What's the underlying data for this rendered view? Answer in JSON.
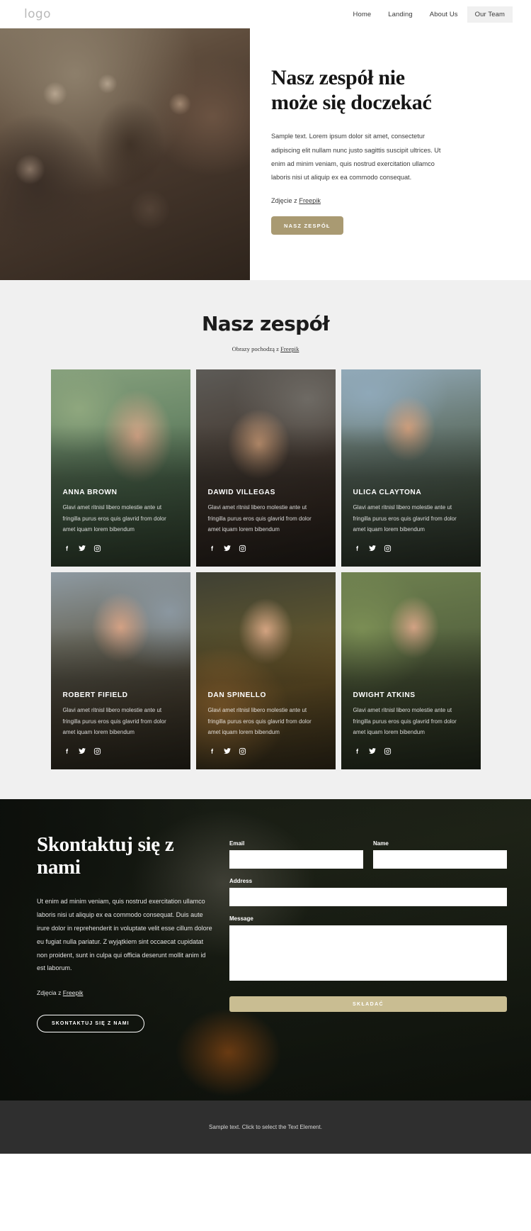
{
  "header": {
    "logo": "logo",
    "nav": [
      {
        "label": "Home",
        "active": false
      },
      {
        "label": "Landing",
        "active": false
      },
      {
        "label": "About Us",
        "active": false
      },
      {
        "label": "Our Team",
        "active": true
      }
    ]
  },
  "hero": {
    "title": "Nasz zespół nie może się doczekać",
    "paragraph": "Sample text. Lorem ipsum dolor sit amet, consectetur adipiscing elit nullam nunc justo sagittis suscipit ultrices. Ut enim ad minim veniam, quis nostrud exercitation ullamco laboris nisi ut aliquip ex ea commodo consequat.",
    "credit_prefix": "Zdjęcie z ",
    "credit_link": "Freepik",
    "cta_label": "NASZ ZESPÓŁ",
    "image_alt": "group-of-friends-outdoors-photo"
  },
  "team": {
    "title": "Nasz zespół",
    "subtitle_prefix": "Obrazy pochodzą z ",
    "subtitle_link": "Freepik",
    "members": [
      {
        "name": "ANNA BROWN",
        "description": "Glavi amet ritnisl libero molestie ante ut fringilla purus eros quis glavrid from dolor amet iquam lorem bibendum",
        "photo_class": "p1"
      },
      {
        "name": "DAWID VILLEGAS",
        "description": "Glavi amet ritnisl libero molestie ante ut fringilla purus eros quis glavrid from dolor amet iquam lorem bibendum",
        "photo_class": "p2"
      },
      {
        "name": "ULICA CLAYTONA",
        "description": "Glavi amet ritnisl libero molestie ante ut fringilla purus eros quis glavrid from dolor amet iquam lorem bibendum",
        "photo_class": "p3"
      },
      {
        "name": "ROBERT FIFIELD",
        "description": "Glavi amet ritnisl libero molestie ante ut fringilla purus eros quis glavrid from dolor amet iquam lorem bibendum",
        "photo_class": "p4"
      },
      {
        "name": "DAN SPINELLO",
        "description": "Glavi amet ritnisl libero molestie ante ut fringilla purus eros quis glavrid from dolor amet iquam lorem bibendum",
        "photo_class": "p5"
      },
      {
        "name": "DWIGHT ATKINS",
        "description": "Glavi amet ritnisl libero molestie ante ut fringilla purus eros quis glavrid from dolor amet iquam lorem bibendum",
        "photo_class": "p6"
      }
    ],
    "social_icons": [
      "facebook-icon",
      "twitter-icon",
      "instagram-icon"
    ]
  },
  "contact": {
    "title": "Skontaktuj się z nami",
    "paragraph": "Ut enim ad minim veniam, quis nostrud exercitation ullamco laboris nisi ut aliquip ex ea commodo consequat. Duis aute irure dolor in reprehenderit in voluptate velit esse cillum dolore eu fugiat nulla pariatur. Z wyjątkiem sint occaecat cupidatat non proident, sunt in culpa qui officia deserunt mollit anim id est laborum.",
    "credit_prefix": "Zdjęcia z ",
    "credit_link": "Freepik",
    "cta_label": "SKONTAKTUJ SIĘ Z NAMI",
    "form": {
      "email_label": "Email",
      "email_value": "",
      "email_placeholder": "",
      "name_label": "Name",
      "name_value": "",
      "name_placeholder": "",
      "address_label": "Address",
      "address_value": "",
      "address_placeholder": "",
      "message_label": "Message",
      "message_value": "",
      "message_placeholder": "",
      "submit_label": "SKŁADAĆ"
    }
  },
  "footer": {
    "text": "Sample text. Click to select the Text Element."
  },
  "colors": {
    "accent_button": "#a99a72",
    "submit_button": "#c9bd92",
    "team_bg": "#f0f0f0",
    "footer_bg": "#2f2f2f",
    "nav_active_bg": "#f0f0f0"
  }
}
